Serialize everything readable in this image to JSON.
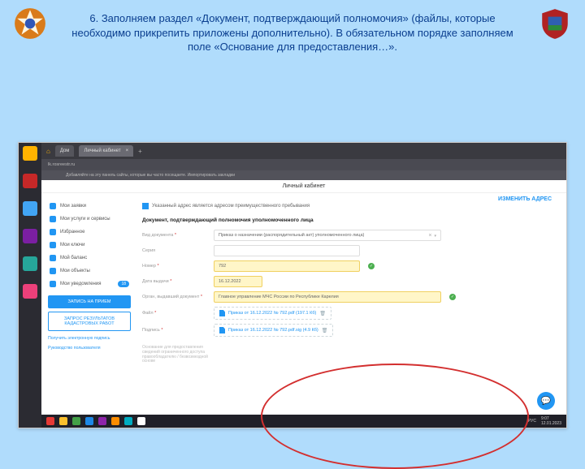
{
  "slide": {
    "title": "6. Заполняем раздел «Документ, подтверждающий полномочия» (файлы, которые необходимо прикрепить приложены дополнительно). В обязательном порядке заполняем поле «Основание для предоставления…»."
  },
  "browser": {
    "tabs": [
      {
        "label": "Дом"
      },
      {
        "label": "Личный кабинет"
      }
    ],
    "url": "lk.rosreestr.ru",
    "bookmark_hint": "Добавляйте на эту панель сайты, которые вы часто посещаете. Импортировать закладки"
  },
  "site": {
    "header": "Личный кабинет"
  },
  "sidebar": {
    "items": [
      {
        "label": "Мои заявки"
      },
      {
        "label": "Мои услуги и сервисы"
      },
      {
        "label": "Избранное"
      },
      {
        "label": "Мои ключи"
      },
      {
        "label": "Мой баланс"
      },
      {
        "label": "Мои объекты"
      },
      {
        "label": "Мои уведомления",
        "badge": "18"
      }
    ],
    "cta_primary": "ЗАПИСЬ НА ПРИЕМ",
    "cta_secondary": "ЗАПРОС РЕЗУЛЬТАТОВ КАДАСТРОВЫХ РАБОТ",
    "link1": "Получить электронную подпись",
    "link2": "Руководство пользователя"
  },
  "main": {
    "change_address": "ИЗМЕНИТЬ АДРЕС",
    "checkbox_label": "Указанный адрес является адресом преимущественного пребывания",
    "section_title": "Документ, подтверждающий полномочия уполномоченного лица",
    "labels": {
      "doctype": "Вид документа",
      "series": "Серия",
      "number": "Номер",
      "date": "Дата выдачи",
      "issuer": "Орган, выдавший документ",
      "file": "Файл",
      "signature": "Подпись",
      "basis": "Основание для предоставления сведений ограниченного доступа правообладателю / безвозмездной основе"
    },
    "values": {
      "doctype": "Приказ о назначении (распорядительный акт) уполномоченного лица)",
      "number": "792",
      "date": "16.12.2022",
      "issuer": "Главное управление МЧС России по Республике Карелия"
    },
    "files": {
      "file": "Приказ от 16.12.2022 № 792.pdf  (197.1 Кб)",
      "sig": "Приказ от 16.12.2022 № 792.pdf.sig  (4.9 Кб)"
    }
  },
  "taskbar": {
    "lang": "РУС",
    "time": "9:07",
    "date": "12.01.2023"
  }
}
